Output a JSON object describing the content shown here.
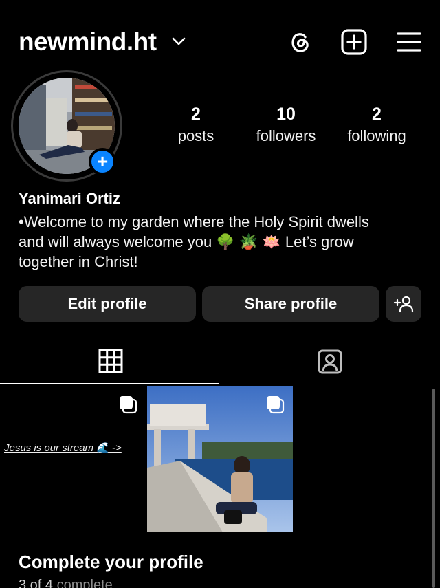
{
  "header": {
    "username": "newmind.ht",
    "icons": [
      "chevron-down-icon",
      "threads-icon",
      "create-post-icon",
      "menu-icon"
    ]
  },
  "profile": {
    "avatar_badge": "+",
    "stats": [
      {
        "num": "2",
        "label": "posts"
      },
      {
        "num": "10",
        "label": "followers"
      },
      {
        "num": "2",
        "label": "following"
      }
    ],
    "full_name": "Yanimari Ortiz",
    "bio_line1": "•Welcome to my garden where the Holy Spirit dwells",
    "bio_line2": "and will always welcome you 🌳 🪴 🪷 Let’s grow",
    "bio_line3": "together in Christ!"
  },
  "actions": {
    "edit_label": "Edit profile",
    "share_label": "Share profile",
    "add_user_icon": "add-person-icon"
  },
  "tabs": [
    {
      "name": "grid",
      "icon": "grid-icon",
      "active": true
    },
    {
      "name": "tagged",
      "icon": "tagged-icon",
      "active": false
    }
  ],
  "posts": [
    {
      "caption": "Jesus is our stream 🌊 ->",
      "multi": true
    },
    {
      "caption": "",
      "multi": true
    }
  ],
  "complete_profile": {
    "title": "Complete your profile",
    "progress": "3 of 4",
    "progress_suffix": "complete"
  },
  "colors": {
    "background": "#000000",
    "button_bg": "#262626",
    "accent_blue": "#0a84ff"
  }
}
